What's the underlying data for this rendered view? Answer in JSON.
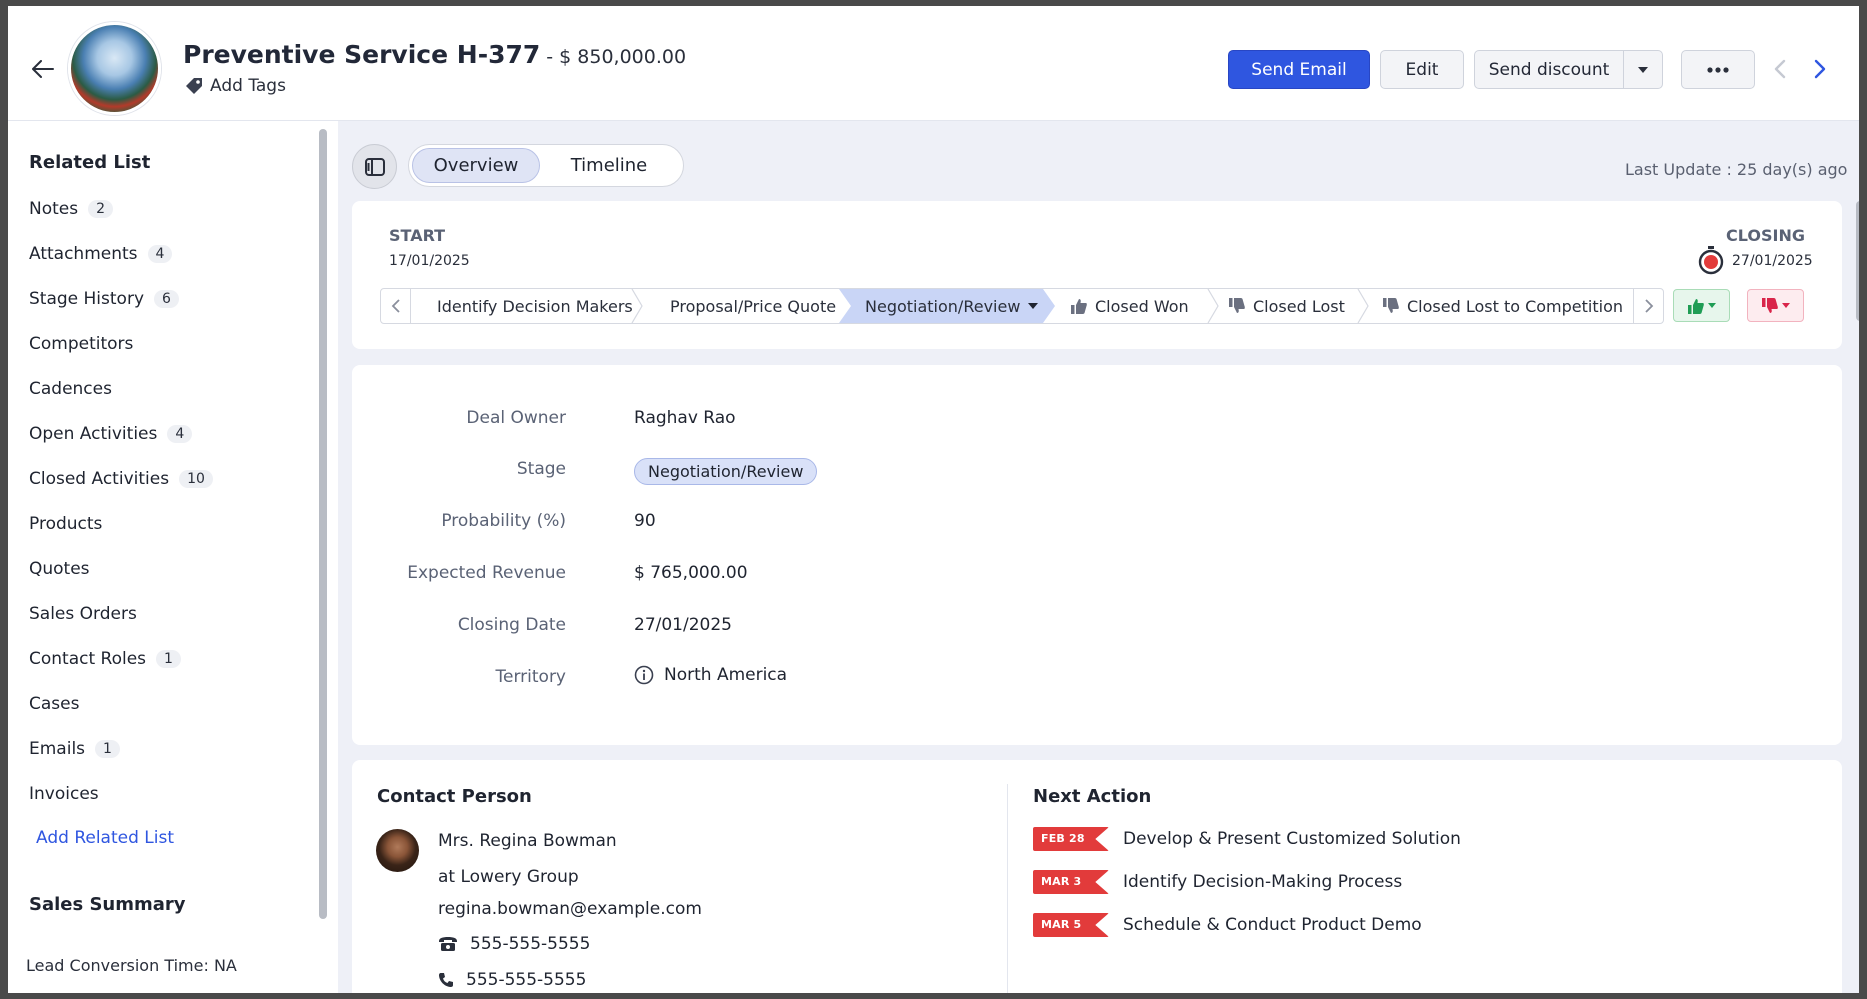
{
  "header": {
    "title": "Preventive Service H-377",
    "amount": "- $ 850,000.00",
    "add_tags": "Add Tags",
    "buttons": {
      "send_email": "Send Email",
      "edit": "Edit",
      "send_discount": "Send discount",
      "more": "•••"
    }
  },
  "sidebar": {
    "related_title": "Related List",
    "items": [
      {
        "label": "Notes",
        "count": "2"
      },
      {
        "label": "Attachments",
        "count": "4"
      },
      {
        "label": "Stage History",
        "count": "6"
      },
      {
        "label": "Competitors",
        "count": ""
      },
      {
        "label": "Cadences",
        "count": ""
      },
      {
        "label": "Open Activities",
        "count": "4"
      },
      {
        "label": "Closed Activities",
        "count": "10"
      },
      {
        "label": "Products",
        "count": ""
      },
      {
        "label": "Quotes",
        "count": ""
      },
      {
        "label": "Sales Orders",
        "count": ""
      },
      {
        "label": "Contact Roles",
        "count": "1"
      },
      {
        "label": "Cases",
        "count": ""
      },
      {
        "label": "Emails",
        "count": "1"
      },
      {
        "label": "Invoices",
        "count": ""
      }
    ],
    "add_related": "Add Related List",
    "sales_summary_title": "Sales Summary",
    "lead_conversion": "Lead Conversion Time: NA"
  },
  "main": {
    "tabs": {
      "overview": "Overview",
      "timeline": "Timeline"
    },
    "last_update": "Last Update : 25 day(s) ago",
    "stage_card": {
      "start_label": "START",
      "start_date": "17/01/2025",
      "closing_label": "CLOSING",
      "closing_date": "27/01/2025",
      "stages": [
        "Identify Decision Makers",
        "Proposal/Price Quote",
        "Negotiation/Review",
        "Closed Won",
        "Closed Lost",
        "Closed Lost to Competition"
      ],
      "current_stage": "Negotiation/Review"
    },
    "details": {
      "deal_owner_label": "Deal Owner",
      "deal_owner": "Raghav Rao",
      "stage_label": "Stage",
      "stage": "Negotiation/Review",
      "probability_label": "Probability (%)",
      "probability": "90",
      "expected_revenue_label": "Expected Revenue",
      "expected_revenue": "$ 765,000.00",
      "closing_date_label": "Closing Date",
      "closing_date": "27/01/2025",
      "territory_label": "Territory",
      "territory": "North America"
    },
    "contact": {
      "title": "Contact Person",
      "name": "Mrs. Regina Bowman",
      "company": "at Lowery Group",
      "email": "regina.bowman@example.com",
      "phone": "555-555-5555",
      "mobile": "555-555-5555"
    },
    "next_action": {
      "title": "Next Action",
      "items": [
        {
          "date": "FEB 28",
          "text": "Develop & Present Customized Solution"
        },
        {
          "date": "MAR 3",
          "text": "Identify Decision-Making Process"
        },
        {
          "date": "MAR 5",
          "text": "Schedule & Conduct Product Demo"
        }
      ]
    }
  },
  "colors": {
    "primary": "#2f56e0",
    "won": "#1f9d55",
    "lost": "#d9254a",
    "flag": "#e23b3b"
  }
}
